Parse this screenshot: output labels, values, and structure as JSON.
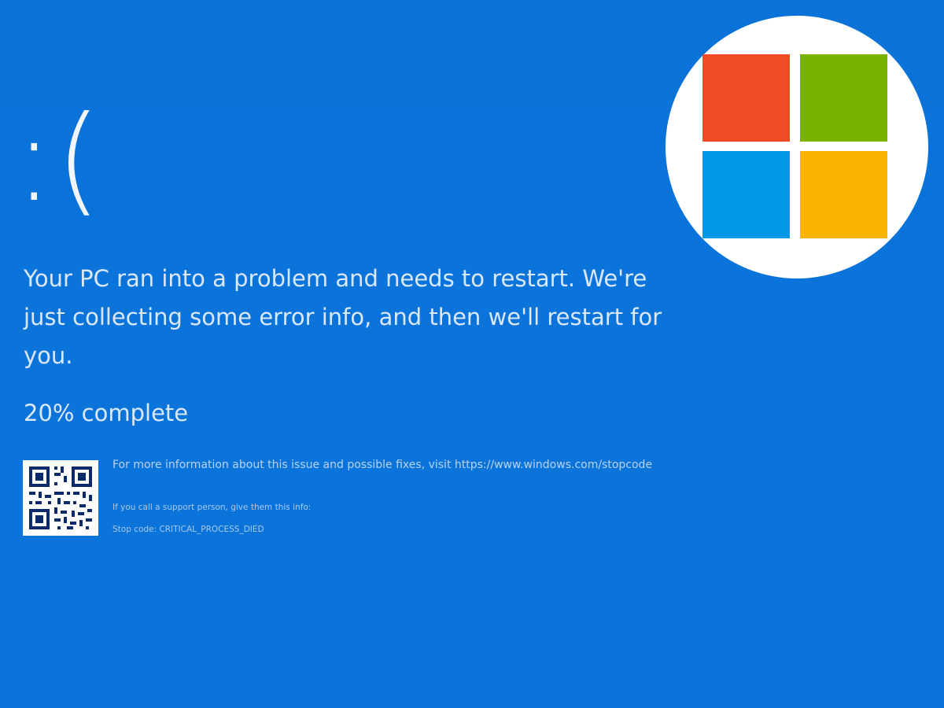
{
  "bsod": {
    "face": ":(",
    "message": "Your PC ran into a problem and needs to restart. We're just collecting some error info, and then we'll restart for you.",
    "progress_text": "20% complete",
    "info_text": "For more information about this issue and possible fixes, visit https://www.windows.com/stopcode",
    "support_text": "If you call a support person, give them this info:",
    "stop_code_text": "Stop code: CRITICAL_PROCESS_DIED"
  },
  "logo": {
    "name": "microsoft-logo",
    "colors": {
      "red": "#f25022",
      "green": "#7fba00",
      "blue": "#00a4ef",
      "yellow": "#ffb900"
    }
  },
  "colors": {
    "background": "#0a74da",
    "text": "#dbe8f8"
  }
}
